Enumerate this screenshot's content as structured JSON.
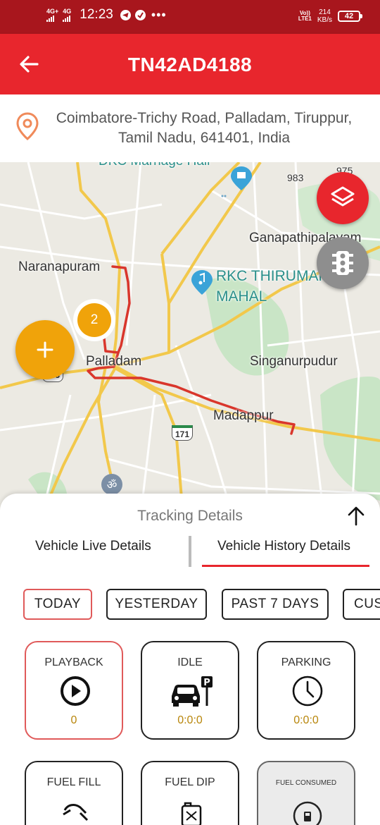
{
  "status_bar": {
    "sim1": "4G+",
    "sim2": "4G",
    "time": "12:23",
    "overflow": "•••",
    "volte_line1": "Vo))",
    "volte_line2": "LTE1",
    "speed_value": "214",
    "speed_unit": "KB/s",
    "battery": "42"
  },
  "app_bar": {
    "title": "TN42AD4188",
    "back_icon": "arrow-left-icon"
  },
  "address": {
    "text": "Coimbatore-Trichy Road, Palladam, Tiruppur, Tamil Nadu, 641401, India",
    "icon": "location-pin-icon"
  },
  "map": {
    "labels": {
      "top_partial": "DKC Marriage Hall",
      "road_number_983": "983",
      "road_number_975": "975",
      "ganapathipalayam": "Ganapathipalayam",
      "naranapuram": "Naranapuram",
      "rkc_line1": "RKC THIRUMAN",
      "rkc_line2": "MAHAL",
      "palladam": "Palladam",
      "singanurpudur": "Singanurpudur",
      "madappur": "Madappur",
      "highway_171": "171",
      "highway_183": "183"
    },
    "cluster_count": "2",
    "buttons": {
      "layers": "layers-icon",
      "traffic": "traffic-light-icon",
      "add": "plus-icon"
    },
    "colors": {
      "route": "#d9362c",
      "major_road": "#f2c84b",
      "green_area": "#c9e5c6",
      "background": "#eceae3"
    }
  },
  "sheet": {
    "title": "Tracking Details",
    "collapse_icon": "arrow-up-icon",
    "tabs": {
      "live": "Vehicle Live Details",
      "history": "Vehicle History Details"
    },
    "chips": {
      "today": "TODAY",
      "yesterday": "YESTERDAY",
      "past7": "PAST 7 DAYS",
      "custom": "CUSTOM"
    },
    "cards": {
      "playback": {
        "label": "PLAYBACK",
        "value": "0",
        "icon": "play-circle-icon"
      },
      "idle": {
        "label": "IDLE",
        "value": "0:0:0",
        "icon": "car-parking-icon"
      },
      "parking": {
        "label": "PARKING",
        "value": "0:0:0",
        "icon": "clock-icon"
      },
      "fuel_fill": {
        "label": "FUEL FILL",
        "icon": "fuel-nozzle-icon"
      },
      "fuel_dip": {
        "label": "FUEL DIP",
        "icon": "jerrycan-icon"
      },
      "fuel_consumed": {
        "label": "FUEL CONSUMED",
        "icon": "fuel-gauge-icon"
      }
    },
    "accent": "#e8262d",
    "value_color": "#b8860b"
  }
}
